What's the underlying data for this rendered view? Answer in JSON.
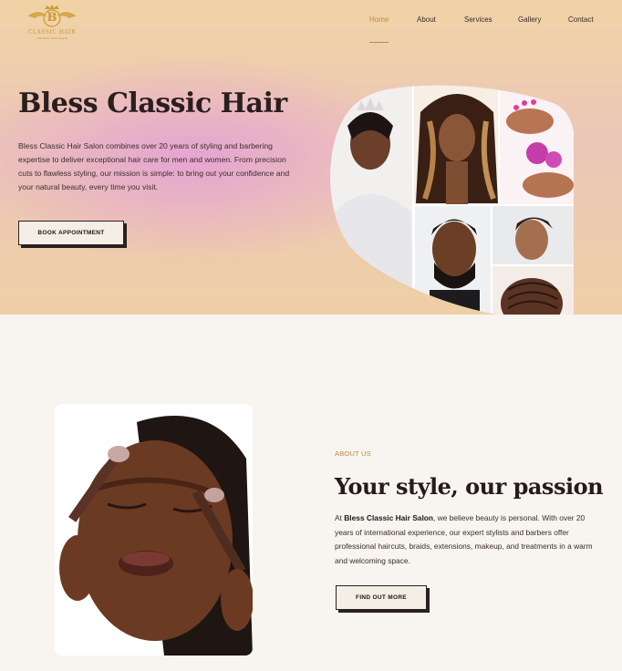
{
  "brand": {
    "logo_initial": "B",
    "logo_text": "CLASSIC HAIR",
    "logo_tagline": "THE BEST HAIR SALON",
    "accent_color": "#c28a3a"
  },
  "nav": {
    "items": [
      {
        "label": "Home",
        "active": true
      },
      {
        "label": "About",
        "active": false
      },
      {
        "label": "Services",
        "active": false
      },
      {
        "label": "Gallery",
        "active": false
      },
      {
        "label": "Contact",
        "active": false
      }
    ]
  },
  "hero": {
    "title": "Bless Classic Hair",
    "description": "Bless Classic Hair Salon combines over 20 years of styling and barbering expertise to deliver exceptional hair care for men and women. From precision cuts to flawless styling, our mission is simple: to bring out your confidence and your natural beauty, every time you visit.",
    "cta_label": "BOOK APPOINTMENT"
  },
  "about": {
    "kicker": "ABOUT US",
    "title": "Your style, our passion",
    "desc_prefix": "At ",
    "desc_brand": "Bless Classic Hair Salon",
    "desc_rest": ", we believe beauty is personal. With over 20 years of international experience, our expert stylists and barbers offer professional haircuts, braids, extensions, makeup, and treatments in a warm and welcoming space.",
    "cta_label": "FIND OUT MORE"
  }
}
